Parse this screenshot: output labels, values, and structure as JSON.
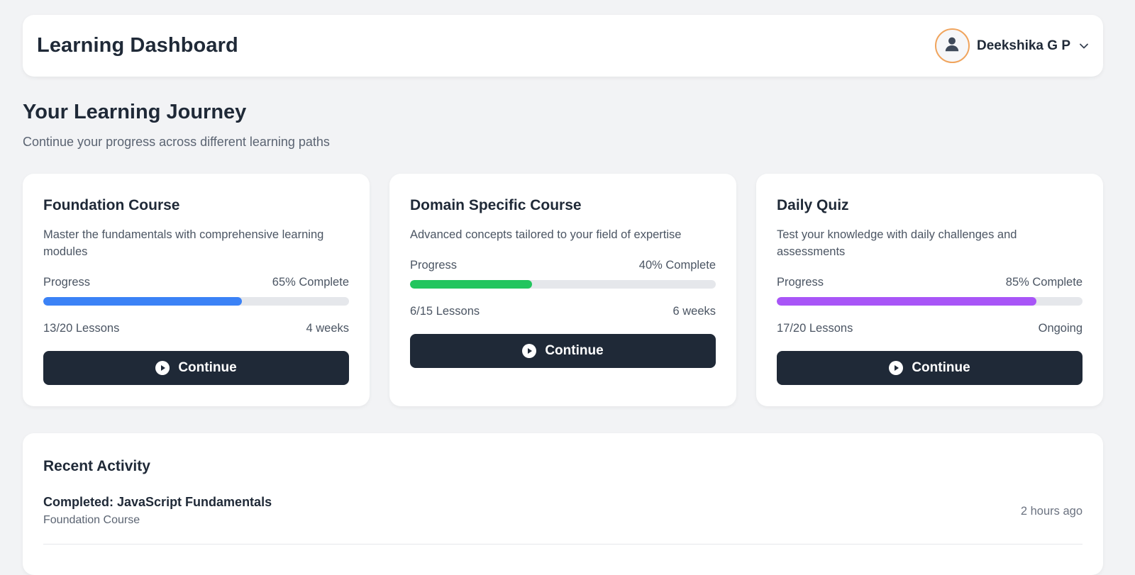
{
  "header": {
    "title": "Learning Dashboard",
    "user_name": "Deekshika G P",
    "avatar_icon": "user-icon",
    "menu_icon": "chevron-down-icon",
    "avatar_border_color": "#f0a45d"
  },
  "journey": {
    "title": "Your Learning Journey",
    "subtitle": "Continue your progress across different learning paths"
  },
  "courses": [
    {
      "title": "Foundation Course",
      "description": "Master the fundamentals with comprehensive learning modules",
      "progress_label": "Progress",
      "progress_text": "65% Complete",
      "progress": 65,
      "color": "#3b82f6",
      "lessons": "13/20 Lessons",
      "duration": "4 weeks",
      "button_label": "Continue",
      "button_icon": "play-circle-icon"
    },
    {
      "title": "Domain Specific Course",
      "description": "Advanced concepts tailored to your field of expertise",
      "progress_label": "Progress",
      "progress_text": "40% Complete",
      "progress": 40,
      "color": "#22c55e",
      "lessons": "6/15 Lessons",
      "duration": "6 weeks",
      "button_label": "Continue",
      "button_icon": "play-circle-icon"
    },
    {
      "title": "Daily Quiz",
      "description": "Test your knowledge with daily challenges and assessments",
      "progress_label": "Progress",
      "progress_text": "85% Complete",
      "progress": 85,
      "color": "#a855f7",
      "lessons": "17/20 Lessons",
      "duration": "Ongoing",
      "button_label": "Continue",
      "button_icon": "play-circle-icon"
    }
  ],
  "activity": {
    "title": "Recent Activity",
    "items": [
      {
        "name": "Completed: JavaScript Fundamentals",
        "course": "Foundation Course",
        "time": "2 hours ago"
      }
    ]
  }
}
